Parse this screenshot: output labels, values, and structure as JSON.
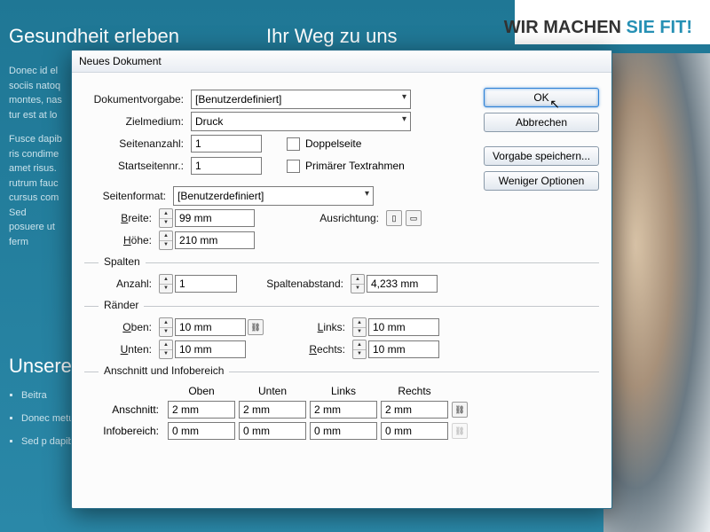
{
  "bg": {
    "left_title": "Gesundheit erleben",
    "left_p1": "Donec id el sociis natoq montes, nas tur est at lo",
    "left_p2": "Fusce dapib ris condime amet risus. rutrum fauc cursus com Sed posuere ut ferm",
    "mid_title": "Ihr Weg zu uns",
    "right_a": "WIR MACHEN ",
    "right_b": "SIE FIT!",
    "lower_title": "Unsere",
    "lower_items": [
      "Beitra",
      "Donec metu",
      "Sed p dapib"
    ]
  },
  "dlg": {
    "title": "Neues Dokument",
    "preset_label": "Dokumentvorgabe:",
    "preset_value": "[Benutzerdefiniert]",
    "intent_label": "Zielmedium:",
    "intent_value": "Druck",
    "pages_label": "Seitenanzahl:",
    "pages_value": "1",
    "facing_label": "Doppelseite",
    "start_label": "Startseitennr.:",
    "start_value": "1",
    "primary_label": "Primärer Textrahmen",
    "pagesize_label": "Seitenformat:",
    "pagesize_value": "[Benutzerdefiniert]",
    "width_label": "Breite:",
    "width_value": "99 mm",
    "height_label": "Höhe:",
    "height_value": "210 mm",
    "orient_label": "Ausrichtung:",
    "columns_title": "Spalten",
    "col_count_label": "Anzahl:",
    "col_count_value": "1",
    "gutter_label": "Spaltenabstand:",
    "gutter_value": "4,233 mm",
    "margins_title": "Ränder",
    "top_label": "Oben:",
    "bottom_label": "Unten:",
    "left_label": "Links:",
    "right_label": "Rechts:",
    "m_top": "10 mm",
    "m_bottom": "10 mm",
    "m_left": "10 mm",
    "m_right": "10 mm",
    "bleed_title": "Anschnitt und Infobereich",
    "hdr_top": "Oben",
    "hdr_bottom": "Unten",
    "hdr_left": "Links",
    "hdr_right": "Rechts",
    "bleed_label": "Anschnitt:",
    "slug_label": "Infobereich:",
    "b_top": "2 mm",
    "b_bottom": "2 mm",
    "b_left": "2 mm",
    "b_right": "2 mm",
    "s_top": "0 mm",
    "s_bottom": "0 mm",
    "s_left": "0 mm",
    "s_right": "0 mm",
    "ok": "OK",
    "cancel": "Abbrechen",
    "save": "Vorgabe speichern...",
    "less": "Weniger Optionen"
  }
}
